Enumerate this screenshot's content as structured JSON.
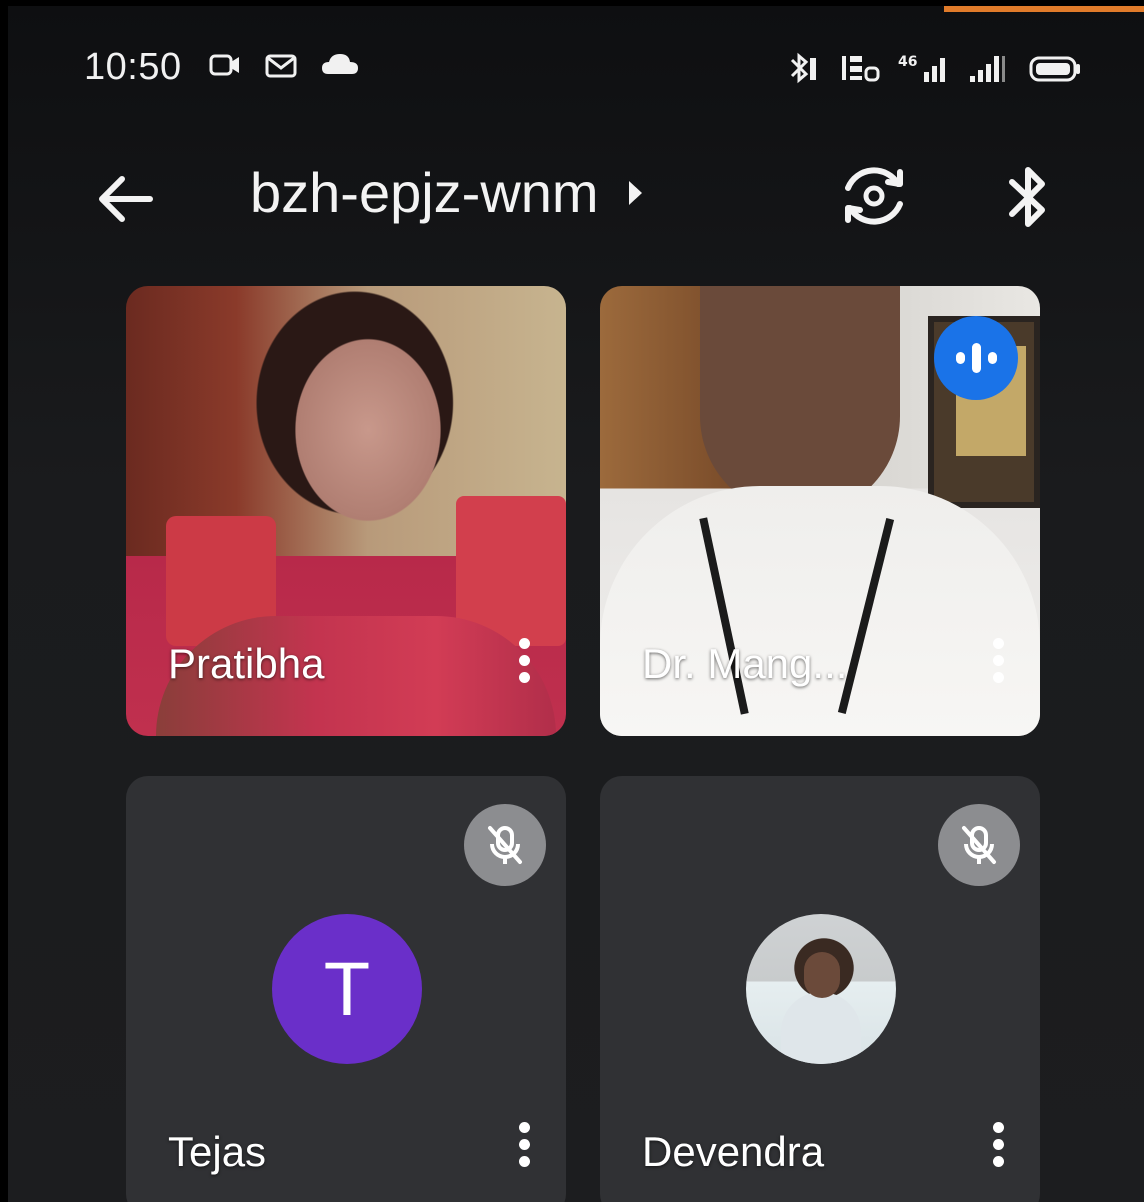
{
  "status_bar": {
    "time": "10:50",
    "left_icons": [
      "video-call-icon",
      "gmail-icon",
      "cloud-icon"
    ],
    "right_icons": [
      "bluetooth-icon",
      "volte-icon",
      "signal-4g-icon",
      "signal-icon",
      "battery-icon"
    ]
  },
  "app_bar": {
    "meeting_code": "bzh-epjz-wnm"
  },
  "participants": [
    {
      "name": "Pratibha",
      "type": "video",
      "state": "video"
    },
    {
      "name": "Dr. Mang...",
      "type": "video",
      "state": "speaking"
    },
    {
      "name": "Tejas",
      "type": "avatar",
      "avatar_letter": "T",
      "state": "muted",
      "avatar_color": "#6a2fc9"
    },
    {
      "name": "Devendra",
      "type": "avatar-photo",
      "state": "muted"
    }
  ],
  "colors": {
    "speaking_badge": "#1a73e8",
    "muted_badge": "#8c8d90",
    "tile_bg": "#303134",
    "accent": "#e07b2a"
  }
}
